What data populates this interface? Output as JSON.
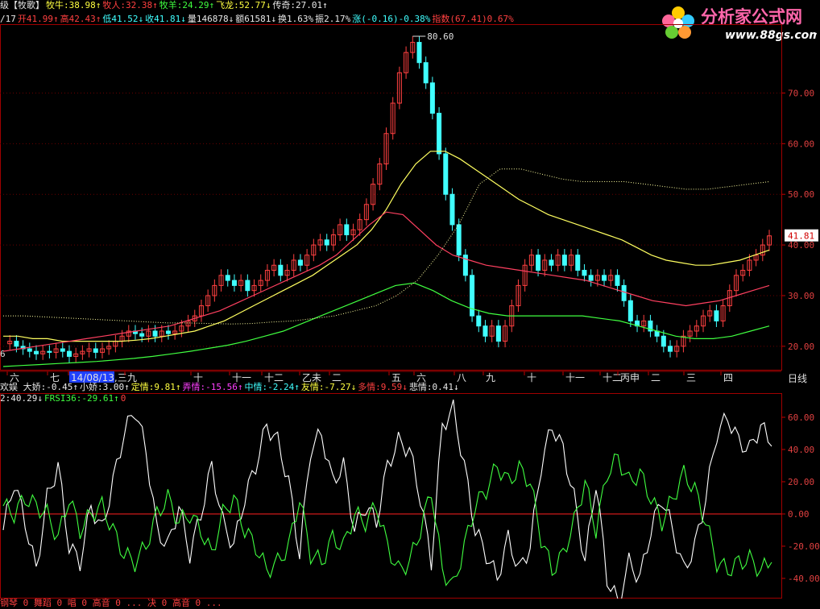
{
  "header": {
    "row1": [
      {
        "text": "级【牧歌】",
        "color": "wht"
      },
      {
        "text": "牧牛:38.98↑",
        "color": "yel"
      },
      {
        "text": "牧人:32.38↑",
        "color": "red"
      },
      {
        "text": "牧羊:24.29↑",
        "color": "grn"
      },
      {
        "text": "飞龙:52.77↓",
        "color": "yel"
      },
      {
        "text": "传奇:27.01↑",
        "color": "wht"
      }
    ],
    "row2": [
      {
        "text": "/17",
        "color": "wht"
      },
      {
        "text": "开41.99↑",
        "color": "red"
      },
      {
        "text": "高42.43↑",
        "color": "red"
      },
      {
        "text": "低41.52↓",
        "color": "cyan"
      },
      {
        "text": "收41.81↓",
        "color": "cyan"
      },
      {
        "text": "量146878↓",
        "color": "wht"
      },
      {
        "text": "额61581↓",
        "color": "wht"
      },
      {
        "text": "换1.63%",
        "color": "wht"
      },
      {
        "text": "振2.17%",
        "color": "wht"
      },
      {
        "text": "涨(-0.16)-0.38%",
        "color": "cyan"
      },
      {
        "text": "指数(67.41)0.67%",
        "color": "red"
      }
    ]
  },
  "logo": {
    "text": "分析家公式网",
    "url": "www.88gs.com"
  },
  "chart_data": [
    {
      "type": "line",
      "ylim": [
        16,
        82
      ],
      "yticks": [
        "70.00",
        "60.00",
        "50.00",
        "40.00",
        "30.00",
        "20.00"
      ],
      "peak_label": "80.60",
      "last_price": "41.81",
      "x_ticks": [
        "六",
        "七",
        "14/08/13,三",
        "九",
        "十",
        "十一",
        "十二",
        "乙未",
        "二",
        "五",
        "六",
        "八",
        "九",
        "十",
        "十一",
        "十二",
        "丙申",
        "二",
        "三",
        "四"
      ],
      "period": "日线",
      "left_edge_label": "6",
      "price": [
        20.5,
        21,
        20,
        19.5,
        19,
        18.5,
        19,
        18.8,
        19.5,
        19,
        18,
        18.5,
        19,
        19.5,
        18.8,
        19.5,
        20,
        21,
        22,
        23,
        22.5,
        22,
        23,
        22,
        23,
        22.5,
        23,
        24,
        25,
        26,
        28,
        30,
        32,
        34,
        33,
        32,
        33,
        31,
        32,
        33,
        35,
        36,
        34,
        35,
        37,
        36,
        38,
        40,
        41,
        40,
        42,
        44,
        42,
        43,
        45,
        48,
        52,
        56,
        62,
        68,
        74,
        78,
        80,
        76,
        72,
        66,
        58,
        50,
        44,
        38,
        34,
        26,
        24,
        22,
        24,
        21,
        24,
        28,
        32,
        36,
        38,
        35,
        37,
        36,
        38,
        36,
        38,
        35,
        34,
        33,
        34,
        33,
        34,
        32,
        29,
        25,
        24,
        25,
        23,
        22,
        20,
        19,
        20,
        22,
        23,
        24,
        26,
        27,
        25,
        28,
        31,
        34,
        35,
        37,
        38,
        40,
        41.8
      ],
      "series": [
        {
          "color": "#ffff60",
          "values": [
            22,
            22,
            21.5,
            21.5,
            21,
            21,
            21,
            21,
            21,
            21.2,
            21.5,
            22,
            22.5,
            23,
            24,
            25,
            26.5,
            28,
            29.5,
            31,
            32.5,
            34,
            36,
            38,
            40,
            43,
            47,
            52,
            56,
            58.5,
            58.5,
            57,
            55,
            53,
            51,
            49,
            47.5,
            46,
            45,
            44,
            43,
            42,
            41,
            39.5,
            38,
            37,
            36.5,
            36,
            36,
            36.5,
            37,
            38,
            39
          ]
        },
        {
          "color": "#ff4060",
          "values": [
            19,
            19.5,
            20,
            20.5,
            21,
            21.5,
            22,
            22.5,
            23,
            23.5,
            24,
            25,
            26,
            27,
            28.5,
            30,
            31.5,
            33,
            34.5,
            36,
            38,
            41,
            44,
            46.5,
            46,
            43,
            40,
            38,
            37,
            36,
            35.5,
            35,
            34.5,
            34,
            33.5,
            33,
            32,
            31,
            30,
            29,
            28.5,
            28,
            28.5,
            29,
            30,
            31,
            32
          ]
        },
        {
          "color": "#40ff40",
          "values": [
            16,
            16.2,
            16.4,
            16.6,
            16.8,
            17,
            17.3,
            17.6,
            18,
            18.5,
            19,
            19.6,
            20.2,
            21,
            22,
            23,
            24.5,
            26,
            27.5,
            29,
            30.5,
            32,
            32.5,
            31,
            29,
            27.5,
            26.5,
            26,
            26,
            26,
            26,
            26,
            25.5,
            25,
            24,
            23,
            22,
            21.5,
            21.5,
            22,
            23,
            24
          ]
        },
        {
          "color": "#ffffa0",
          "dotted": true,
          "values": [
            26,
            26,
            25.8,
            25.6,
            25.4,
            25.2,
            25,
            24.8,
            24.6,
            24.6,
            24.5,
            24.4,
            24.5,
            24.8,
            25,
            25.5,
            26,
            27,
            28,
            30,
            33,
            38,
            44,
            52,
            55,
            55,
            54,
            53,
            52.5,
            52.5,
            52.5,
            52,
            51.5,
            51,
            51,
            51.5,
            52,
            52.5
          ]
        }
      ]
    },
    {
      "type": "line",
      "ylim": [
        -50,
        72
      ],
      "yticks": [
        "60.00",
        "40.00",
        "20.00",
        "0.00",
        "-20.00",
        "-40.00"
      ],
      "legend": [
        {
          "text": "欢娱 大娇:-0.45↑",
          "color": "wht"
        },
        {
          "text": "小娇:3.00↑",
          "color": "wht"
        },
        {
          "text": "定情:9.81↑",
          "color": "yel"
        },
        {
          "text": "弄情:-15.56↑",
          "color": "mag"
        },
        {
          "text": "中情:-2.24↑",
          "color": "cyan"
        },
        {
          "text": "友情:-7.27↓",
          "color": "yel"
        },
        {
          "text": "多情:9.59↓",
          "color": "red"
        },
        {
          "text": "悲情:0.41↓",
          "color": "wht"
        }
      ],
      "legend2": [
        {
          "text": "2:40.29↓",
          "color": "wht"
        },
        {
          "text": "FRSI36:-29.61↑",
          "color": "grn"
        },
        {
          "text": "0",
          "color": "red"
        }
      ],
      "series": [
        {
          "color": "#ffffff",
          "values": [
            -10,
            20,
            -5,
            -35,
            10,
            30,
            -20,
            -30,
            5,
            -10,
            20,
            50,
            65,
            40,
            -10,
            -20,
            5,
            -25,
            0,
            30,
            -5,
            -20,
            10,
            30,
            55,
            45,
            20,
            -25,
            40,
            50,
            20,
            30,
            -10,
            5,
            -5,
            30,
            45,
            40,
            10,
            -30,
            55,
            65,
            30,
            -10,
            -25,
            -40,
            -15,
            -35,
            -20,
            30,
            55,
            40,
            10,
            -30,
            20,
            -40,
            -55,
            -30,
            -40,
            -10,
            10,
            -10,
            -35,
            -20,
            10,
            50,
            60,
            45,
            40,
            55,
            42
          ]
        },
        {
          "color": "#40ff40",
          "values": [
            5,
            0,
            10,
            5,
            0,
            -15,
            10,
            -10,
            0,
            5,
            -10,
            -25,
            -30,
            -20,
            0,
            10,
            -5,
            0,
            -10,
            -25,
            0,
            10,
            -10,
            -20,
            -35,
            -30,
            -20,
            10,
            -25,
            -30,
            -15,
            -20,
            0,
            -5,
            5,
            -20,
            -35,
            -30,
            -10,
            15,
            -35,
            -45,
            -20,
            5,
            15,
            30,
            20,
            28,
            20,
            -15,
            -35,
            -25,
            -5,
            20,
            -10,
            25,
            35,
            20,
            25,
            10,
            -5,
            10,
            25,
            15,
            -5,
            -30,
            -35,
            -30,
            -28,
            -35,
            -30
          ]
        }
      ]
    }
  ],
  "footer": {
    "text": "钢琴 0 舞蹈 0 唱 0 高音 0 ... 决 0 高音 0 ..."
  }
}
